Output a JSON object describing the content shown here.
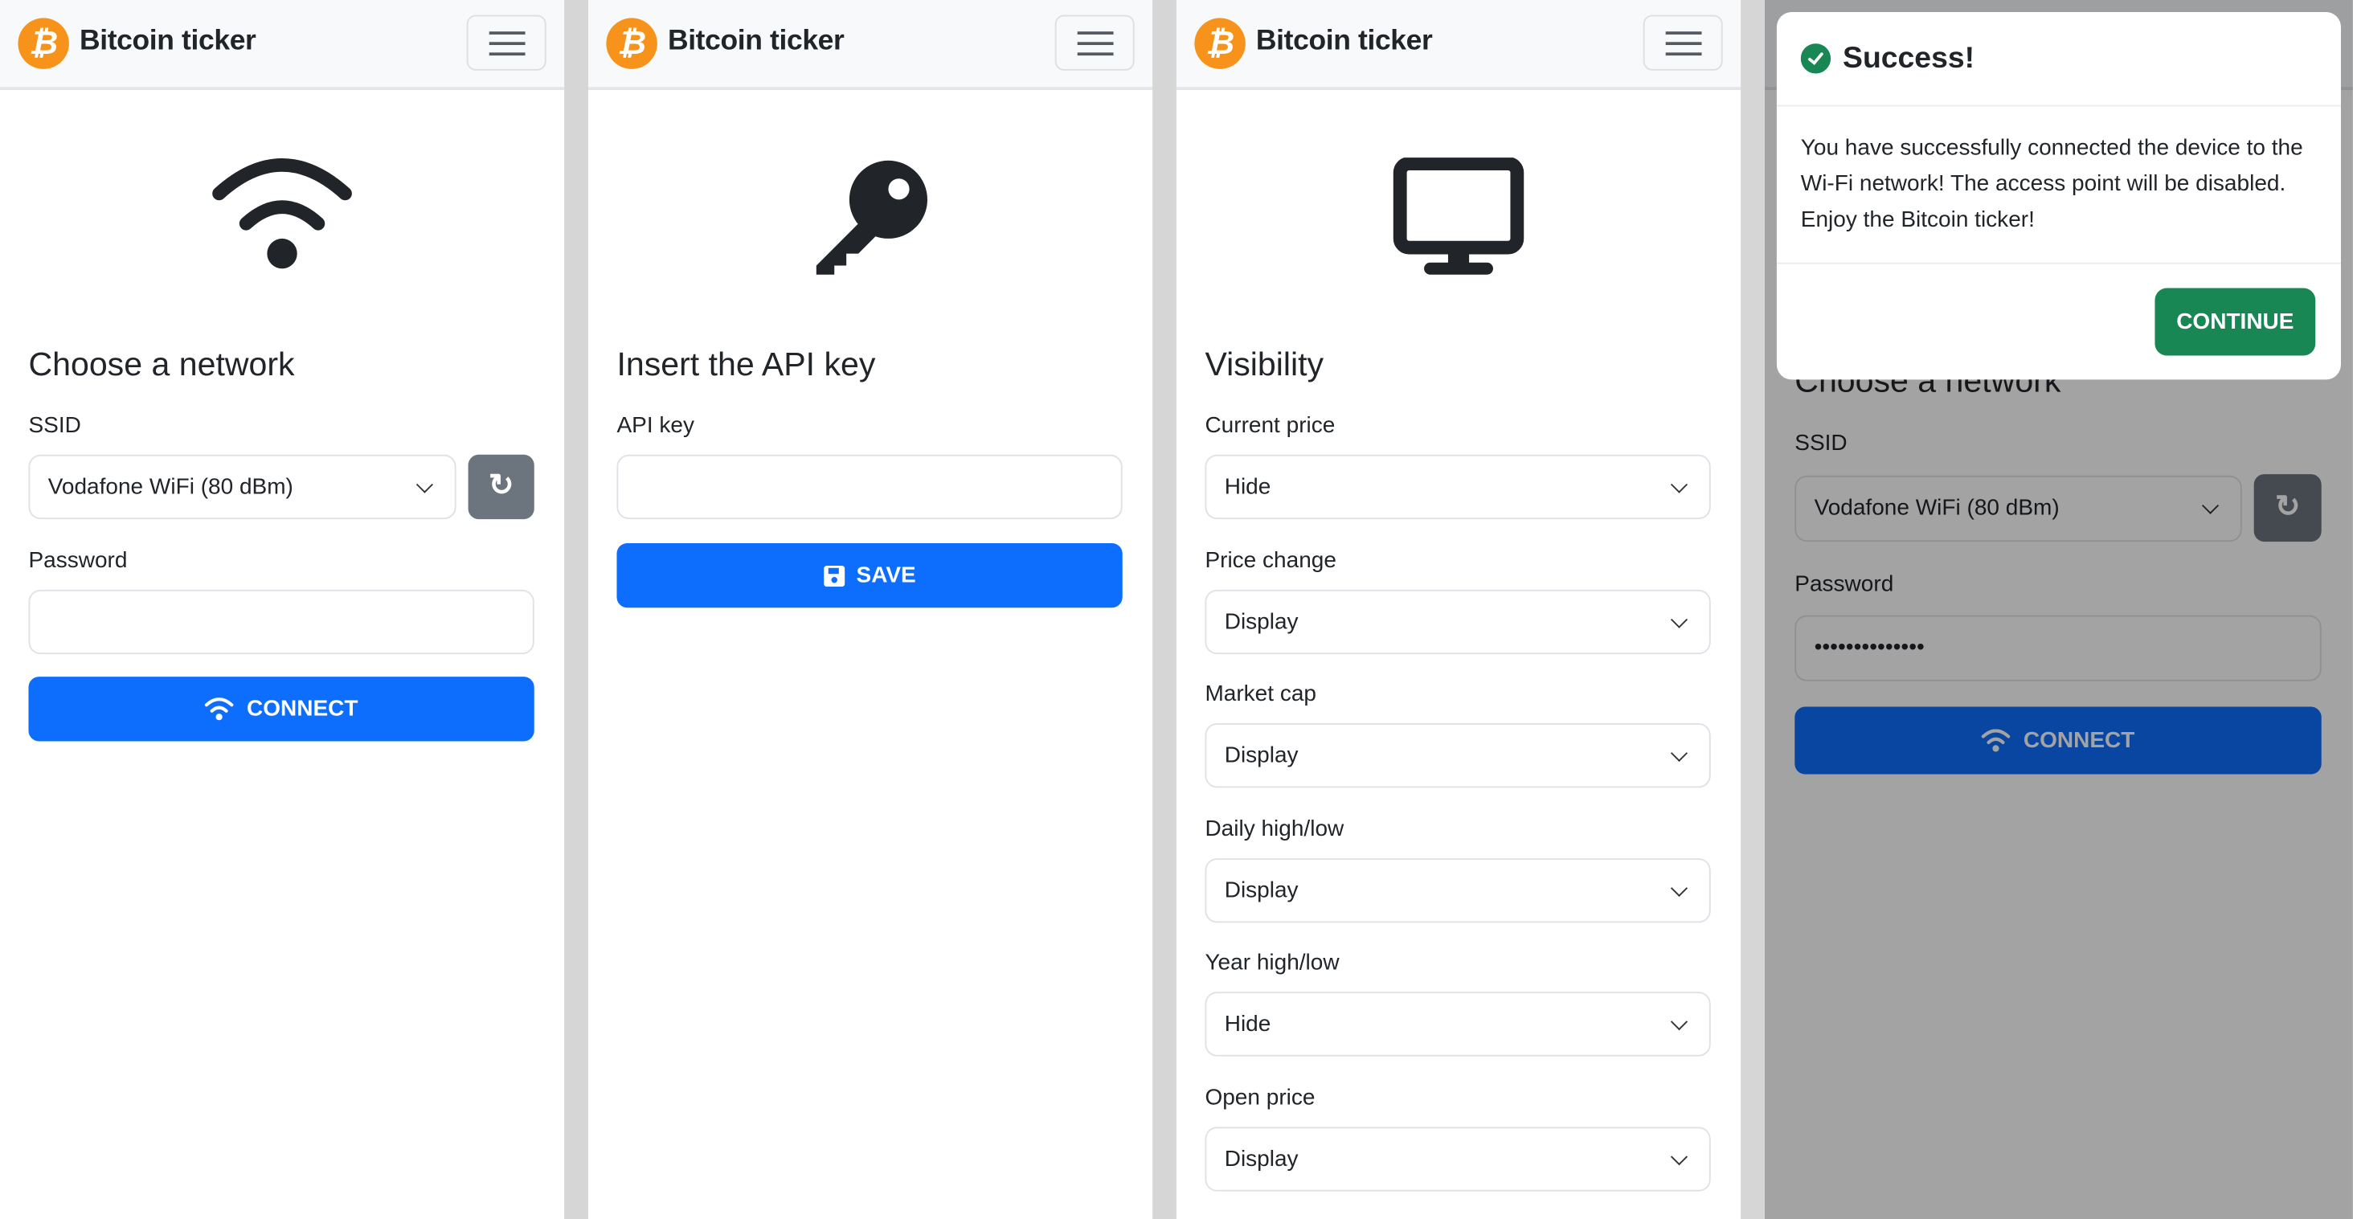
{
  "app": {
    "title": "Bitcoin ticker",
    "logo_glyph": "₿",
    "brand_color": "#f7931a"
  },
  "screen1": {
    "heading": "Choose a network",
    "ssid_label": "SSID",
    "ssid_value": "Vodafone WiFi (80 dBm)",
    "refresh_icon": "↻",
    "password_label": "Password",
    "password_value": "",
    "connect_label": "CONNECT",
    "icon": "wifi-icon"
  },
  "screen2": {
    "heading": "Insert the API key",
    "api_label": "API key",
    "api_value": "",
    "save_label": "SAVE",
    "icon": "key-icon"
  },
  "screen3": {
    "heading": "Visibility",
    "icon": "monitor-icon",
    "fields": [
      {
        "label": "Current price",
        "value": "Hide"
      },
      {
        "label": "Price change",
        "value": "Display"
      },
      {
        "label": "Market cap",
        "value": "Display"
      },
      {
        "label": "Daily high/low",
        "value": "Display"
      },
      {
        "label": "Year high/low",
        "value": "Hide"
      },
      {
        "label": "Open price",
        "value": "Display"
      }
    ]
  },
  "screen4": {
    "heading": "Choose a network",
    "ssid_label": "SSID",
    "ssid_value": "Vodafone WiFi (80 dBm)",
    "refresh_icon": "↻",
    "password_label": "Password",
    "password_value": "••••••••••••••",
    "connect_label": "CONNECT",
    "modal": {
      "title": "Success!",
      "body": "You have successfully connected the device to the Wi-Fi network! The access point will be disabled. Enjoy the Bitcoin ticker!",
      "continue_label": "CONTINUE"
    }
  },
  "colors": {
    "primary": "#0d6efd",
    "success": "#198754",
    "secondary": "#6c757d"
  }
}
